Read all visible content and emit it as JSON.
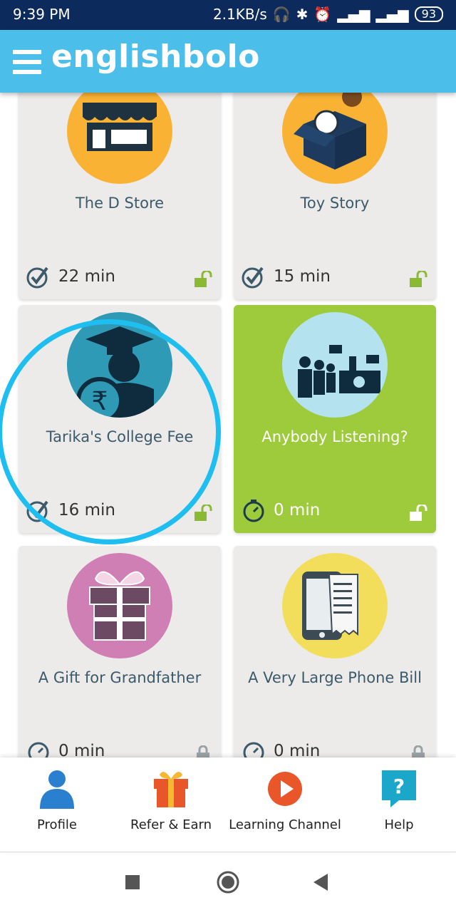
{
  "status_bar": {
    "time": "9:39 PM",
    "speed": "2.1KB/s",
    "battery": "93"
  },
  "app_bar": {
    "logo": "englishbolo"
  },
  "cards": [
    {
      "title": "The D Store",
      "duration": "22 min",
      "circle_color": "#f9b233",
      "completed": true,
      "unlocked": true
    },
    {
      "title": "Toy Story",
      "duration": "15 min",
      "circle_color": "#f9b233",
      "completed": true,
      "unlocked": true
    },
    {
      "title": "Tarika's College Fee",
      "duration": "16 min",
      "circle_color": "#2e9ab5",
      "completed": true,
      "unlocked": true
    },
    {
      "title": "Anybody Listening?",
      "duration": "0 min",
      "circle_color": "#b5e2ef",
      "completed": false,
      "unlocked": true
    },
    {
      "title": "A Gift for Grandfather",
      "duration": "0 min",
      "circle_color": "#d07fb4",
      "completed": false,
      "unlocked": false
    },
    {
      "title": "A Very Large Phone Bill",
      "duration": "0 min",
      "circle_color": "#f2de5b",
      "completed": false,
      "unlocked": false
    }
  ],
  "bottom_nav": [
    {
      "label": "Profile",
      "icon": "person-icon"
    },
    {
      "label": "Refer & Earn",
      "icon": "gift-icon"
    },
    {
      "label": "Learning Channel",
      "icon": "play-icon"
    },
    {
      "label": "Help",
      "icon": "help-icon"
    }
  ],
  "colors": {
    "app_bar": "#4bbfea",
    "status_bar": "#0c2a5b",
    "active_card": "#9dcb3b",
    "highlight_ring": "#1ebff0",
    "unlock_icon": "#8ab933"
  }
}
